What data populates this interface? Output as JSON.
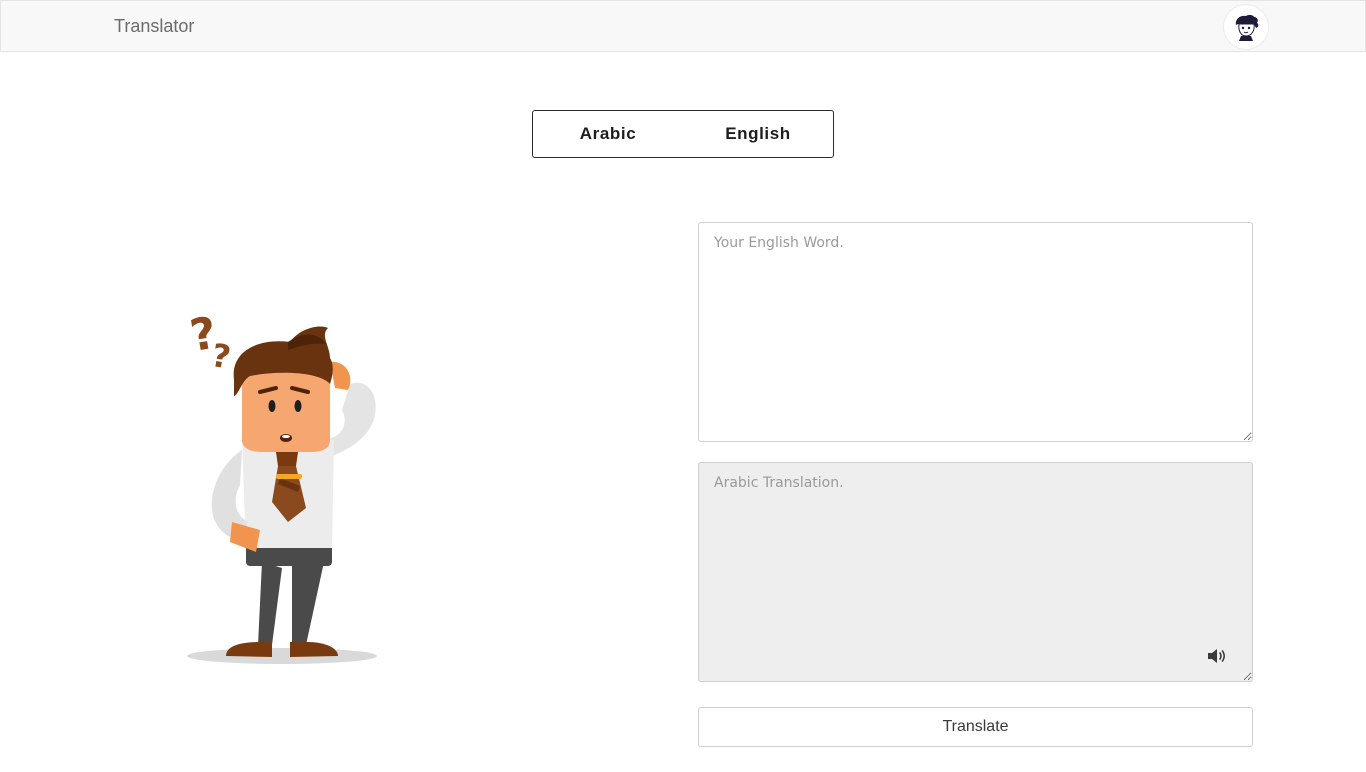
{
  "navbar": {
    "brand": "Translator"
  },
  "language_toggle": {
    "options": [
      "Arabic",
      "English"
    ]
  },
  "input": {
    "placeholder": "Your English Word.",
    "value": ""
  },
  "output": {
    "placeholder": "Arabic Translation.",
    "value": ""
  },
  "translate_button": {
    "label": "Translate"
  },
  "icons": {
    "avatar": "user-avatar-icon",
    "speaker": "speaker-icon",
    "illustration": "confused-man-illustration"
  },
  "colors": {
    "navbar_bg": "#f8f8f8",
    "output_bg": "#eeeeee",
    "accent_brown": "#8a4a1e"
  }
}
